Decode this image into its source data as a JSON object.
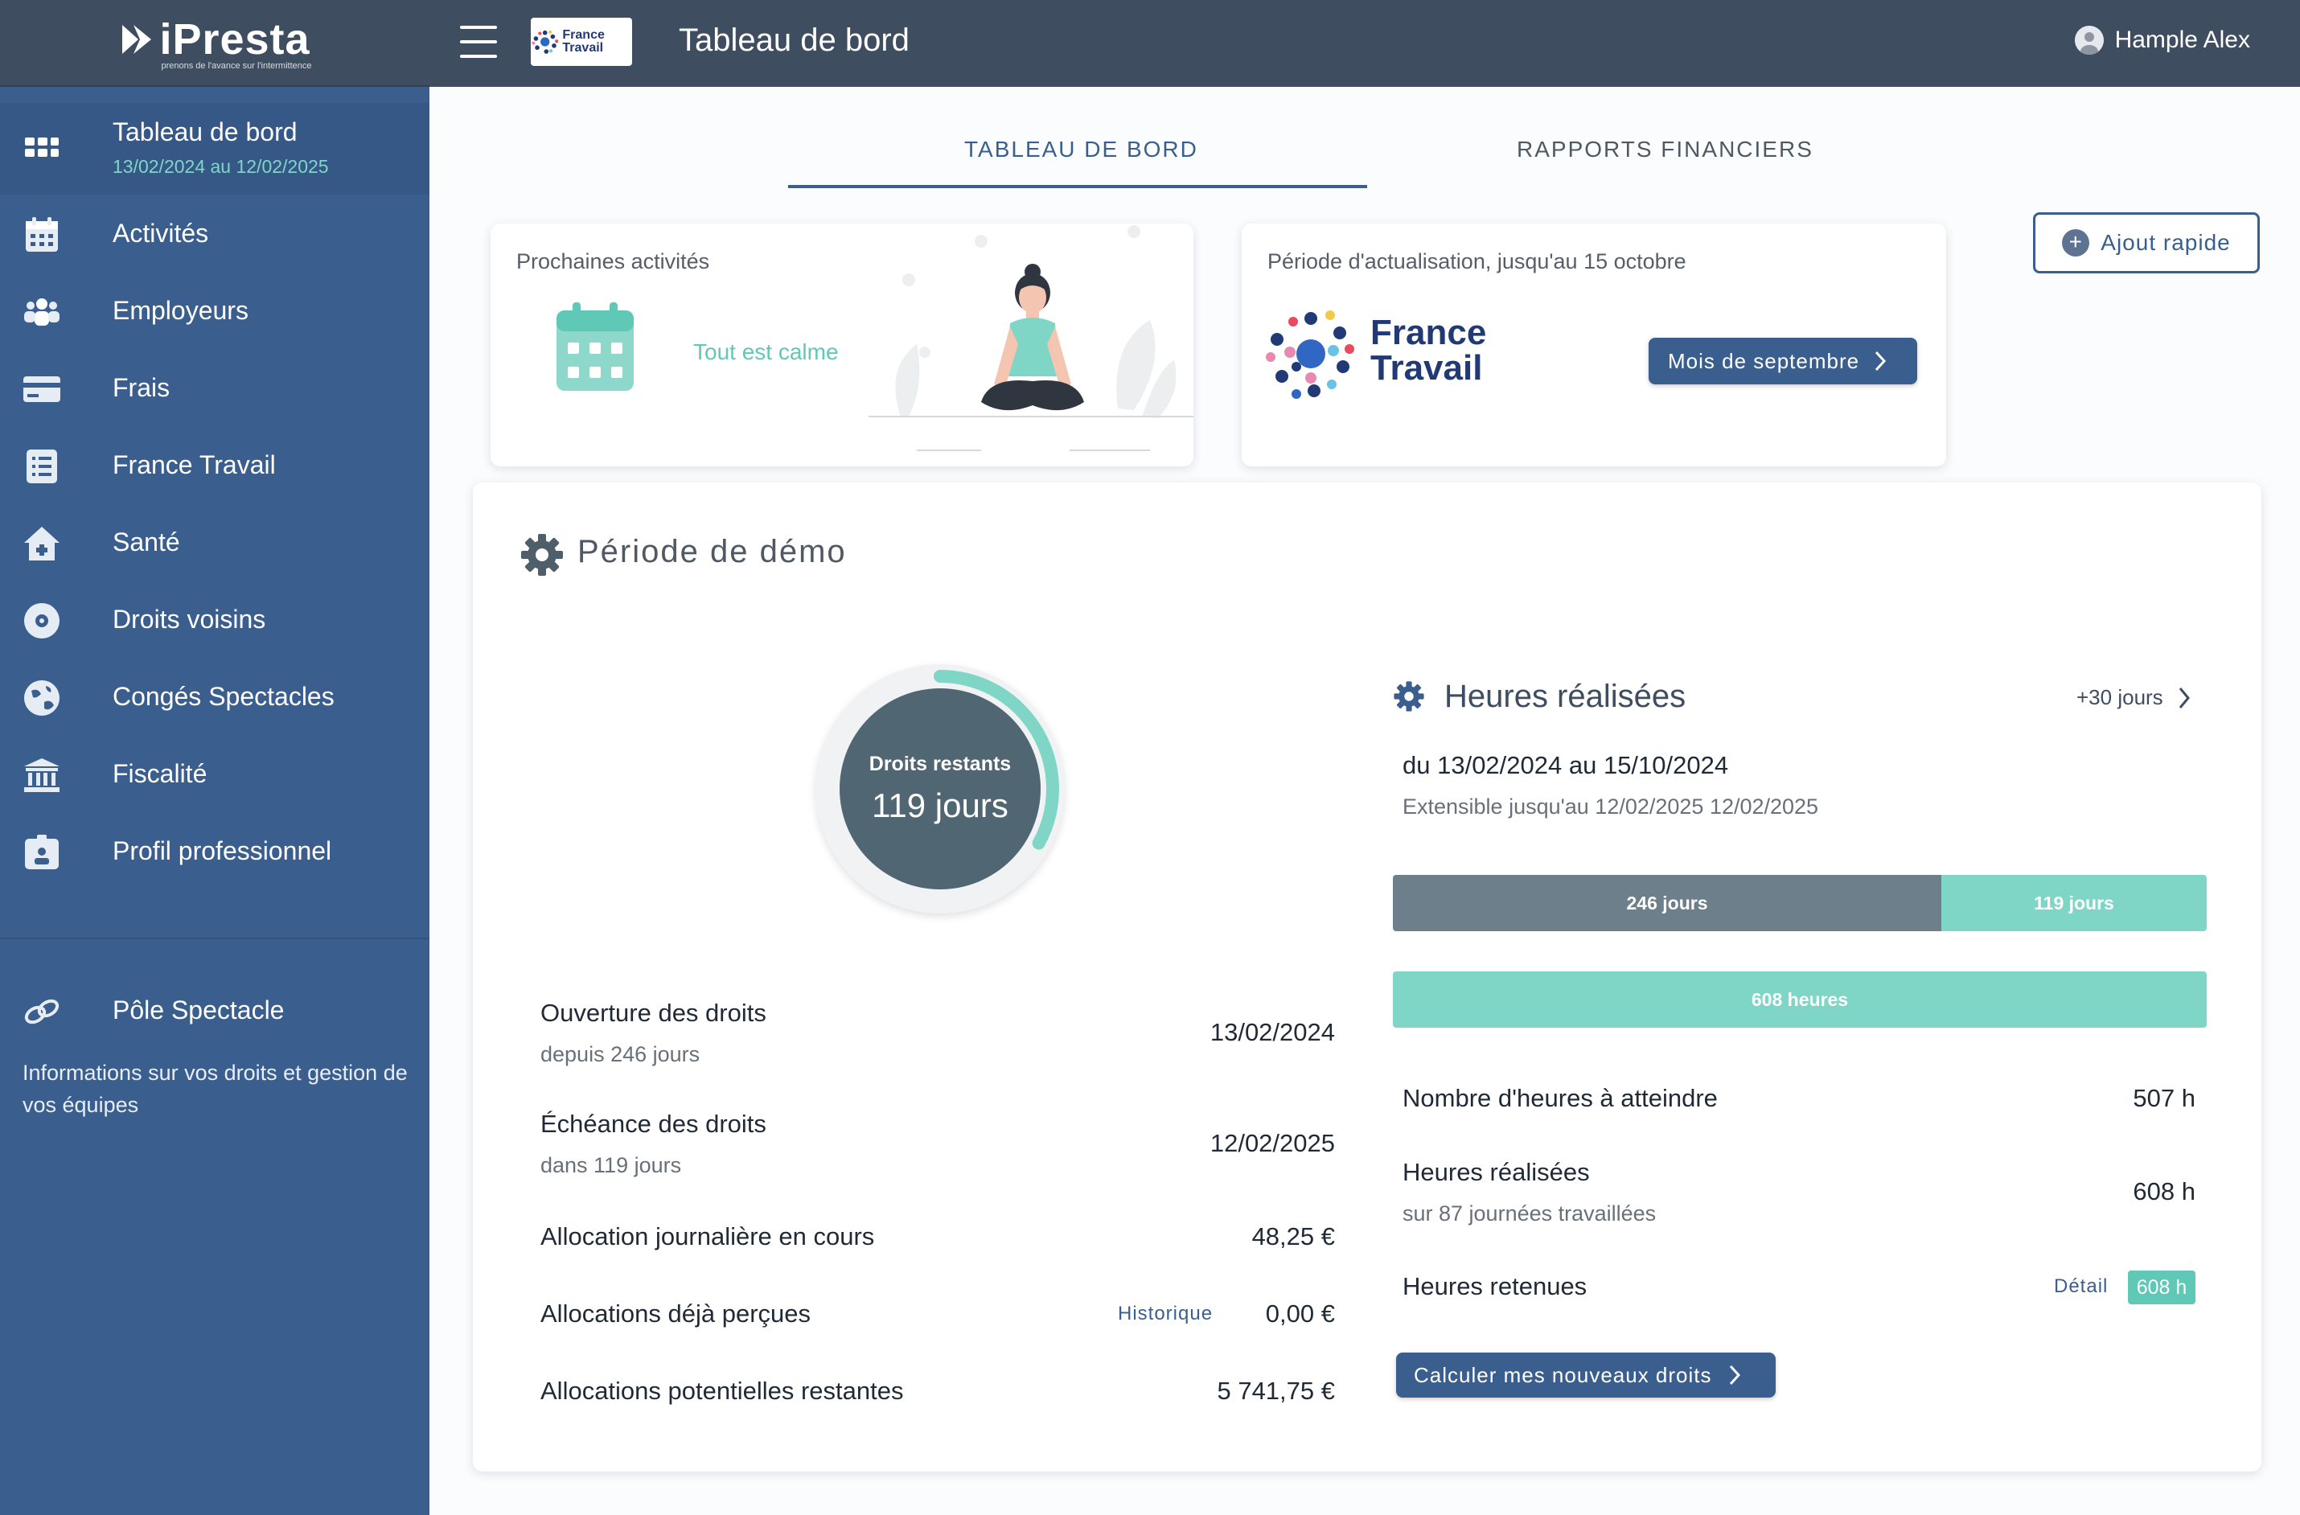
{
  "app": {
    "name": "iPresta",
    "tagline": "prenons de l'avance sur l'intermittence"
  },
  "topbar": {
    "partner_badge": "France Travail",
    "title": "Tableau de bord",
    "user_name": "Hample Alex"
  },
  "sidebar": {
    "items": [
      {
        "label": "Tableau de bord",
        "sub": "13/02/2024 au 12/02/2025",
        "icon": "dashboard-icon",
        "active": true
      },
      {
        "label": "Activités",
        "icon": "calendar-icon"
      },
      {
        "label": "Employeurs",
        "icon": "people-icon"
      },
      {
        "label": "Frais",
        "icon": "credit-card-icon"
      },
      {
        "label": "France Travail",
        "icon": "list-icon"
      },
      {
        "label": "Santé",
        "icon": "health-house-icon"
      },
      {
        "label": "Droits voisins",
        "icon": "disc-icon"
      },
      {
        "label": "Congés Spectacles",
        "icon": "globe-icon"
      },
      {
        "label": "Fiscalité",
        "icon": "bank-icon"
      },
      {
        "label": "Profil professionnel",
        "icon": "id-badge-icon"
      }
    ],
    "pole": {
      "label": "Pôle Spectacle",
      "icon": "link-icon",
      "description": "Informations sur vos droits et gestion de vos équipes"
    }
  },
  "tabs": [
    {
      "label": "TABLEAU DE BORD",
      "active": true
    },
    {
      "label": "RAPPORTS FINANCIERS",
      "active": false
    }
  ],
  "quick_add": {
    "label": "Ajout rapide"
  },
  "next_activities": {
    "title": "Prochaines activités",
    "empty_text": "Tout est calme"
  },
  "update_period": {
    "title": "Période d'actualisation, jusqu'au 15 octobre",
    "logo_line1": "France",
    "logo_line2": "Travail",
    "button": "Mois de septembre"
  },
  "demo": {
    "title": "Période de démo",
    "gauge": {
      "label": "Droits restants",
      "value": "119 jours",
      "fraction": 0.33
    },
    "rows": [
      {
        "label": "Ouverture des droits",
        "sub": "depuis 246 jours",
        "value": "13/02/2024"
      },
      {
        "label": "Échéance des droits",
        "sub": "dans 119 jours",
        "value": "12/02/2025"
      },
      {
        "label": "Allocation journalière en cours",
        "value": "48,25 €"
      },
      {
        "label": "Allocations déjà perçues",
        "link": "Historique",
        "value": "0,00 €"
      },
      {
        "label": "Allocations potentielles restantes",
        "value": "5 741,75 €"
      }
    ]
  },
  "hours": {
    "title": "Heures réalisées",
    "more_link": "+30 jours",
    "period": "du 13/02/2024 au 15/10/2024",
    "extensible": "Extensible jusqu'au 12/02/2025 12/02/2025",
    "bar_days_used": "246 jours",
    "bar_days_left": "119 jours",
    "days_used_fraction": 0.674,
    "bar_hours": "608 heures",
    "rows": [
      {
        "label": "Nombre d'heures à atteindre",
        "value": "507 h"
      },
      {
        "label": "Heures réalisées",
        "sub": "sur 87 journées travaillées",
        "value": "608 h"
      },
      {
        "label": "Heures retenues",
        "link": "Détail",
        "value": "608 h"
      }
    ],
    "cta": "Calculer mes nouveaux droits"
  },
  "colors": {
    "sidebar": "#3a5f8e",
    "topbar": "#3e4d5f",
    "accent": "#7fd6c6",
    "gauge": "#506673",
    "bar_used": "#6e7f8c"
  }
}
